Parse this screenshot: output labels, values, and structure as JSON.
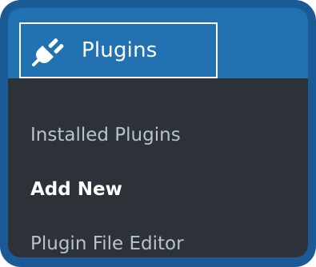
{
  "menu": {
    "header": {
      "label": "Plugins",
      "icon": "plug-icon"
    },
    "items": [
      {
        "label": "Installed Plugins",
        "current": false
      },
      {
        "label": "Add New",
        "current": true
      },
      {
        "label": "Plugin File Editor",
        "current": false
      }
    ]
  },
  "colors": {
    "frame": "#1c5a97",
    "header_bg": "#2271b1",
    "submenu_bg": "#2c3237",
    "item_text": "#b8c3ca",
    "current_text": "#ffffff"
  }
}
